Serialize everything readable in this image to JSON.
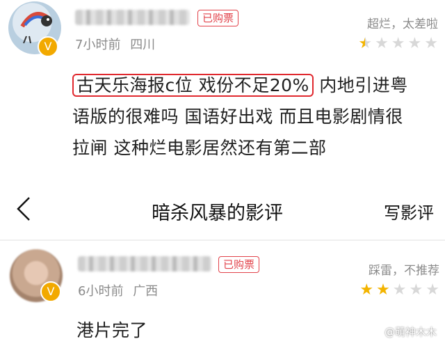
{
  "review1": {
    "badge": "已购票",
    "time": "7小时前",
    "location": "四川",
    "rating_text": "超烂，太差啦",
    "rating": 0.5,
    "text_highlight": "古天乐海报c位 戏份不足20%",
    "text_line1_rest": "内地引进粤",
    "text_line2": "语版的很难吗 国语好出戏 而且电影剧情很",
    "text_line3": "拉闸 这种烂电影居然还有第二部"
  },
  "nav": {
    "back": "〈",
    "title": "暗杀风暴的影评",
    "action": "写影评"
  },
  "review2": {
    "badge": "已购票",
    "time": "6小时前",
    "location": "广西",
    "rating_text": "踩雷，不推荐",
    "rating": 2,
    "text": "港片完了"
  },
  "watermark": "@萌神木木",
  "colors": {
    "badge": "#e2424a",
    "star": "#f3b400",
    "highlight": "#e0282e"
  },
  "icons": {
    "vip": "vip-v-icon",
    "back": "back-chevron-icon",
    "star": "star-icon"
  }
}
